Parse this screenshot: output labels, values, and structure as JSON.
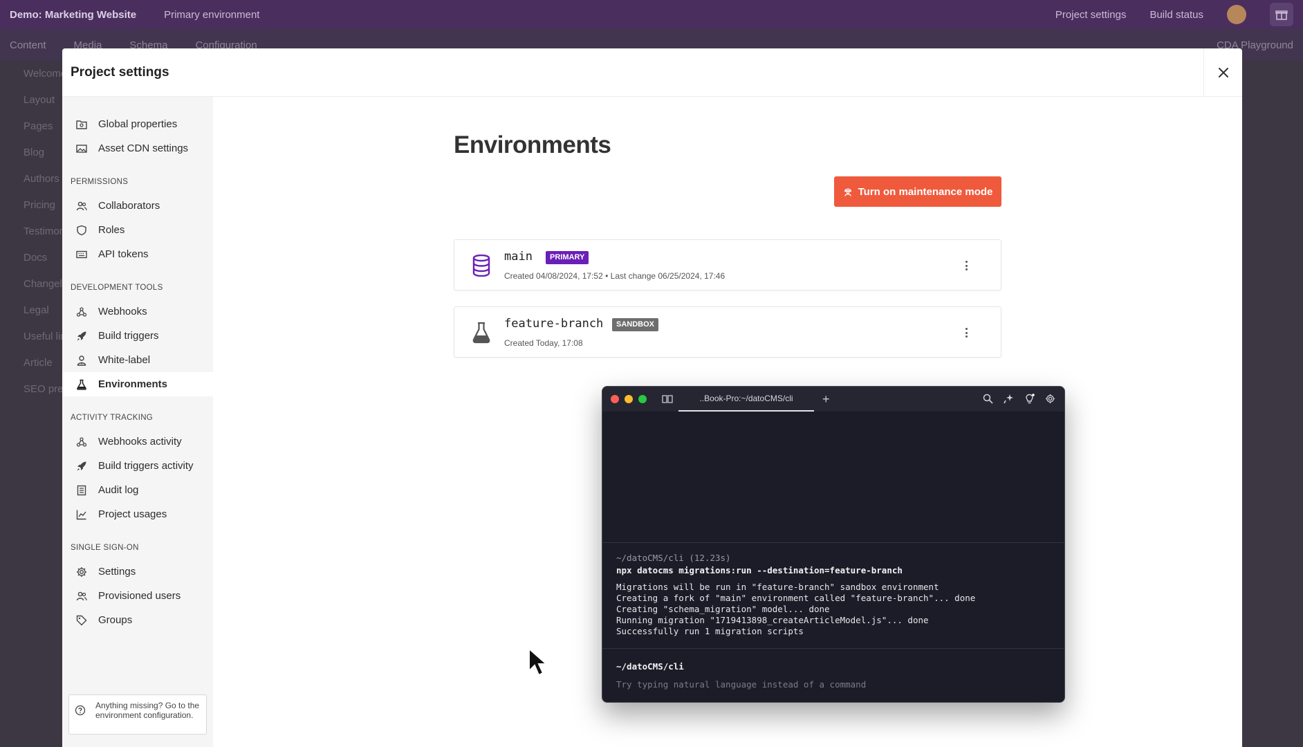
{
  "background": {
    "project_title": "Demo: Marketing Website",
    "environment_selector": "Primary environment",
    "top_right": [
      "Project settings",
      "Build status"
    ],
    "nav_tabs": [
      "Content",
      "Media",
      "Schema",
      "Configuration"
    ],
    "playground": "CDA Playground",
    "sidebar_items": [
      "Welcome",
      "Layout",
      "Pages",
      "Blog",
      "Authors",
      "Pricing",
      "Testimonials",
      "Docs",
      "Changelog",
      "Legal",
      "Useful links",
      "Article",
      "SEO preview"
    ]
  },
  "modal": {
    "title": "Project settings",
    "close_icon": "close-icon"
  },
  "nav": {
    "top_items": [
      {
        "label": "Global properties",
        "icon": "folder-settings-icon"
      },
      {
        "label": "Asset CDN settings",
        "icon": "image-icon"
      }
    ],
    "sections": [
      {
        "title": "PERMISSIONS",
        "items": [
          {
            "label": "Collaborators",
            "icon": "users-icon"
          },
          {
            "label": "Roles",
            "icon": "shield-icon"
          },
          {
            "label": "API tokens",
            "icon": "keyboard-icon"
          }
        ]
      },
      {
        "title": "DEVELOPMENT TOOLS",
        "items": [
          {
            "label": "Webhooks",
            "icon": "webhook-icon"
          },
          {
            "label": "Build triggers",
            "icon": "rocket-icon"
          },
          {
            "label": "White-label",
            "icon": "user-tie-icon"
          },
          {
            "label": "Environments",
            "icon": "flask-icon",
            "active": true
          }
        ]
      },
      {
        "title": "ACTIVITY TRACKING",
        "items": [
          {
            "label": "Webhooks activity",
            "icon": "webhook-icon"
          },
          {
            "label": "Build triggers activity",
            "icon": "rocket-icon"
          },
          {
            "label": "Audit log",
            "icon": "document-icon"
          },
          {
            "label": "Project usages",
            "icon": "chart-icon"
          }
        ]
      },
      {
        "title": "SINGLE SIGN-ON",
        "items": [
          {
            "label": "Settings",
            "icon": "gear-icon"
          },
          {
            "label": "Provisioned users",
            "icon": "users-icon"
          },
          {
            "label": "Groups",
            "icon": "tag-icon"
          }
        ]
      }
    ],
    "help_text": "Anything missing? Go to the environment configuration."
  },
  "main": {
    "title": "Environments",
    "maintenance_button": "Turn on maintenance mode",
    "environments": [
      {
        "name": "main",
        "badge": "PRIMARY",
        "badge_color": "#6a1fb7",
        "meta": "Created 04/08/2024, 17:52 • Last change 06/25/2024, 17:46",
        "icon": "database-icon"
      },
      {
        "name": "feature-branch",
        "badge": "SANDBOX",
        "badge_color": "#6e6e6e",
        "meta": "Created Today, 17:08",
        "icon": "flask-icon"
      }
    ]
  },
  "terminal": {
    "tab_title": "..Book-Pro:~/datoCMS/cli",
    "prompt_header": "~/datoCMS/cli (12.23s)",
    "command": "npx datocms migrations:run --destination=feature-branch",
    "output": [
      "Migrations will be run in \"feature-branch\" sandbox environment",
      "Creating a fork of \"main\" environment called \"feature-branch\"... done",
      "Creating \"schema_migration\" model... done",
      "Running migration \"1719413898_createArticleModel.js\"... done",
      "Successfully run 1 migration scripts"
    ],
    "current_dir": "~/datoCMS/cli",
    "input_placeholder": "Try typing natural language instead of a command"
  },
  "colors": {
    "accent": "#ef5a3d",
    "primary_badge": "#6a1fb7",
    "sandbox_badge": "#6e6e6e",
    "topbar": "#4a2f5e"
  }
}
